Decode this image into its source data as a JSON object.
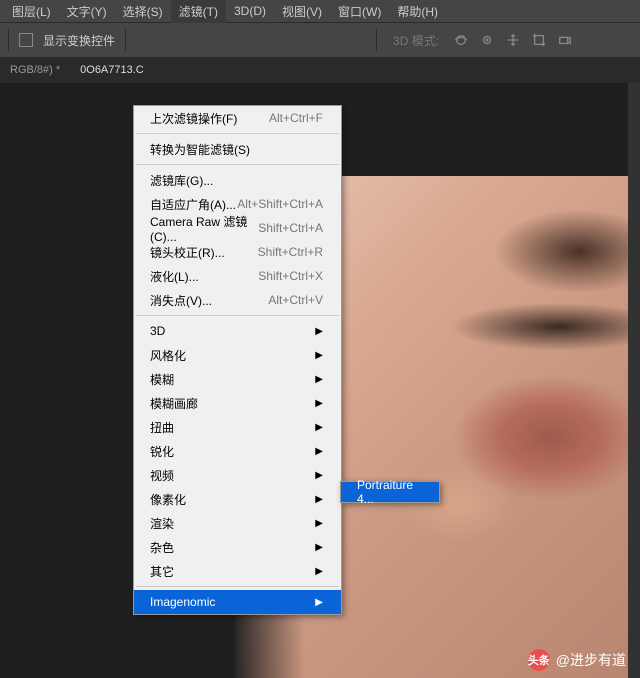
{
  "menubar": {
    "items": [
      "图层(L)",
      "文字(Y)",
      "选择(S)",
      "滤镜(T)",
      "3D(D)",
      "视图(V)",
      "窗口(W)",
      "帮助(H)"
    ],
    "active": "滤镜(T)"
  },
  "optionsbar": {
    "checkbox_label": "显示变换控件",
    "mode_label": "3D 模式:"
  },
  "tabs": {
    "items": [
      "RGB/8#) *",
      "0O6A7713.C"
    ],
    "active": "0O6A7713.C"
  },
  "menu": {
    "s1": [
      {
        "label": "上次滤镜操作(F)",
        "accel": "Alt+Ctrl+F"
      }
    ],
    "s2": [
      {
        "label": "转换为智能滤镜(S)",
        "accel": ""
      }
    ],
    "s3": [
      {
        "label": "滤镜库(G)...",
        "accel": ""
      },
      {
        "label": "自适应广角(A)...",
        "accel": "Alt+Shift+Ctrl+A"
      },
      {
        "label": "Camera Raw 滤镜(C)...",
        "accel": "Shift+Ctrl+A"
      },
      {
        "label": "镜头校正(R)...",
        "accel": "Shift+Ctrl+R"
      },
      {
        "label": "液化(L)...",
        "accel": "Shift+Ctrl+X"
      },
      {
        "label": "消失点(V)...",
        "accel": "Alt+Ctrl+V"
      }
    ],
    "s4": [
      {
        "label": "3D",
        "sub": true
      },
      {
        "label": "风格化",
        "sub": true
      },
      {
        "label": "模糊",
        "sub": true
      },
      {
        "label": "模糊画廊",
        "sub": true
      },
      {
        "label": "扭曲",
        "sub": true
      },
      {
        "label": "锐化",
        "sub": true
      },
      {
        "label": "视频",
        "sub": true
      },
      {
        "label": "像素化",
        "sub": true
      },
      {
        "label": "渲染",
        "sub": true
      },
      {
        "label": "杂色",
        "sub": true
      },
      {
        "label": "其它",
        "sub": true
      }
    ],
    "s5": [
      {
        "label": "Imagenomic",
        "sub": true,
        "sel": true
      }
    ]
  },
  "submenu": {
    "item": "Portraiture 4..."
  },
  "watermark": {
    "logo": "头条",
    "author": "@进步有道"
  }
}
